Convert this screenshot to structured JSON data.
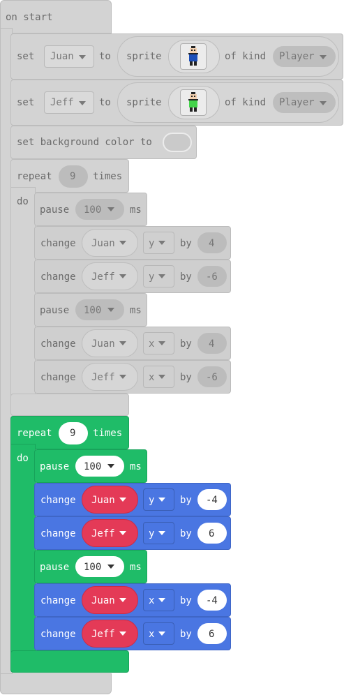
{
  "event": {
    "label": "on start"
  },
  "set1": {
    "set": "set",
    "var": "Juan",
    "to": "to",
    "sprite": "sprite",
    "of_kind": "of kind",
    "kind": "Player"
  },
  "set2": {
    "set": "set",
    "var": "Jeff",
    "to": "to",
    "sprite": "sprite",
    "of_kind": "of kind",
    "kind": "Player"
  },
  "bg": {
    "label": "set background color to"
  },
  "loop1": {
    "repeat": "repeat",
    "count": "9",
    "times": "times",
    "do": "do",
    "rows": [
      {
        "type": "pause",
        "label": "pause",
        "value": "100",
        "unit": "ms"
      },
      {
        "type": "change",
        "label": "change",
        "sprite": "Juan",
        "axis": "y",
        "by": "by",
        "value": "4"
      },
      {
        "type": "change",
        "label": "change",
        "sprite": "Jeff",
        "axis": "y",
        "by": "by",
        "value": "-6"
      },
      {
        "type": "pause",
        "label": "pause",
        "value": "100",
        "unit": "ms"
      },
      {
        "type": "change",
        "label": "change",
        "sprite": "Juan",
        "axis": "x",
        "by": "by",
        "value": "4"
      },
      {
        "type": "change",
        "label": "change",
        "sprite": "Jeff",
        "axis": "x",
        "by": "by",
        "value": "-6"
      }
    ]
  },
  "loop2": {
    "repeat": "repeat",
    "count": "9",
    "times": "times",
    "do": "do",
    "rows": [
      {
        "type": "pause",
        "label": "pause",
        "value": "100",
        "unit": "ms"
      },
      {
        "type": "change",
        "label": "change",
        "sprite": "Juan",
        "axis": "y",
        "by": "by",
        "value": "-4"
      },
      {
        "type": "change",
        "label": "change",
        "sprite": "Jeff",
        "axis": "y",
        "by": "by",
        "value": "6"
      },
      {
        "type": "pause",
        "label": "pause",
        "value": "100",
        "unit": "ms"
      },
      {
        "type": "change",
        "label": "change",
        "sprite": "Juan",
        "axis": "x",
        "by": "by",
        "value": "-4"
      },
      {
        "type": "change",
        "label": "change",
        "sprite": "Jeff",
        "axis": "x",
        "by": "by",
        "value": "6"
      }
    ]
  },
  "colors": {
    "disabled_block": "#d3d3d3",
    "loops_green": "#1fbc68",
    "sprites_blue": "#4a76e2",
    "sprite_var_red": "#e43a57"
  }
}
